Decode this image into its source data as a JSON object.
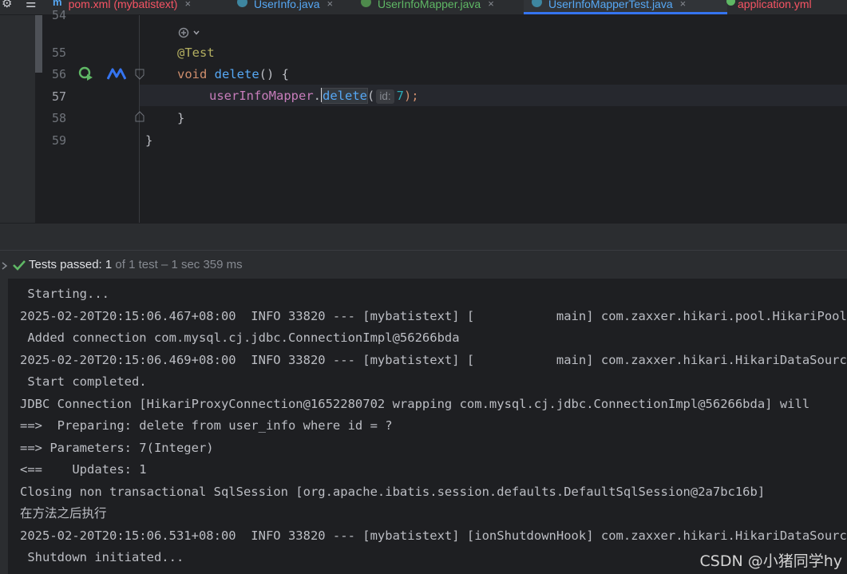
{
  "toolbar": {
    "settings_icon": "gear-icon",
    "menu_icon": "hamburger-icon"
  },
  "tabs": [
    {
      "label": "pom.xml (mybatistext)",
      "icon": "maven-icon",
      "color": "#f75464",
      "active": false
    },
    {
      "label": "UserInfo.java",
      "icon": "class-icon",
      "color": "#56a8f5",
      "active": false
    },
    {
      "label": "UserInfoMapper.java",
      "icon": "interface-icon",
      "color": "#5fb865",
      "active": false
    },
    {
      "label": "UserInfoMapperTest.java",
      "icon": "class-icon",
      "color": "#56a8f5",
      "active": true
    },
    {
      "label": "application.yml",
      "icon": "yaml-icon",
      "color": "#f75464",
      "active": false
    }
  ],
  "tab_close": "×",
  "editor": {
    "line_numbers": [
      "54",
      "55",
      "56",
      "57",
      "58",
      "59"
    ],
    "line55": "@Test",
    "line56": {
      "kw": "void",
      "name": "delete",
      "rest": "() {"
    },
    "line57": {
      "field": "userInfoMapper",
      "dot": ".",
      "method": "delete",
      "open": "(",
      "hint": "id:",
      "value": "7",
      "close": ");"
    },
    "line58": "}",
    "line59": "}"
  },
  "tests": {
    "status": "Tests passed:",
    "count": "1",
    "detail": "of 1 test – 1 sec 359 ms"
  },
  "console": [
    " Starting...",
    "2025-02-20T20:15:06.467+08:00  INFO 33820 --- [mybatistext] [           main] com.zaxxer.hikari.pool.HikariPool",
    " Added connection com.mysql.cj.jdbc.ConnectionImpl@56266bda",
    "2025-02-20T20:15:06.469+08:00  INFO 33820 --- [mybatistext] [           main] com.zaxxer.hikari.HikariDataSource",
    " Start completed.",
    "JDBC Connection [HikariProxyConnection@1652280702 wrapping com.mysql.cj.jdbc.ConnectionImpl@56266bda] will",
    "==>  Preparing: delete from user_info where id = ?",
    "==> Parameters: 7(Integer)",
    "<==    Updates: 1",
    "Closing non transactional SqlSession [org.apache.ibatis.session.defaults.DefaultSqlSession@2a7bc16b]",
    "在方法之后执行",
    "2025-02-20T20:15:06.531+08:00  INFO 33820 --- [mybatistext] [ionShutdownHook] com.zaxxer.hikari.HikariDataSource",
    " Shutdown initiated..."
  ],
  "watermark": "CSDN @小猪同学hy"
}
